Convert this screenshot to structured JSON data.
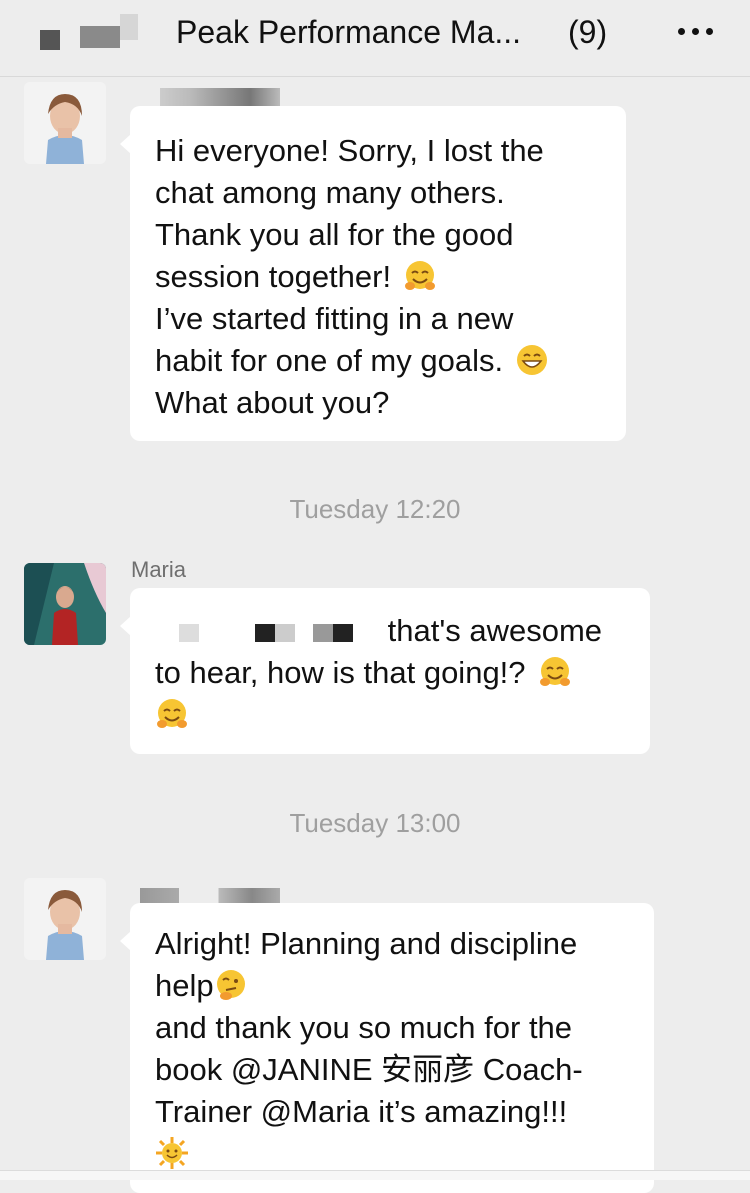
{
  "header": {
    "title": "Peak Performance Ma...",
    "member_count": "(9)"
  },
  "messages": [
    {
      "lines": [
        "Hi everyone! Sorry, I lost the",
        "chat among many others.",
        "Thank you all for the good",
        "session together!",
        "I’ve started fitting in a new",
        "habit for one of my goals.",
        "What about you?"
      ]
    },
    {
      "timestamp": "Tuesday 12:20",
      "sender": "Maria",
      "line1": "that's awesome",
      "line2": "to hear, how is that going!?"
    },
    {
      "timestamp": "Tuesday 13:00",
      "lines": [
        "Alright! Planning and discipline",
        "help",
        "and thank you so much for the",
        "book @JANINE 安丽彦 Coach-",
        "Trainer @Maria it’s amazing!!!"
      ]
    }
  ],
  "colors": {
    "background": "#ededed",
    "bubble": "#ffffff",
    "timestamp": "#9f9f9f"
  }
}
